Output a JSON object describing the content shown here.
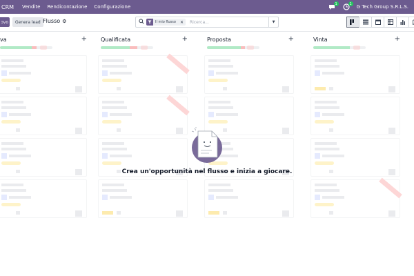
{
  "navbar": {
    "app_name": "CRM",
    "menus": [
      "Vendite",
      "Rendicontazione",
      "Configurazione"
    ],
    "company": "G Tech Group S.R.L.S.",
    "chat_badge": "1",
    "activity_badge": "1",
    "chat_icon": "chat-icon",
    "activity_icon": "clock-icon"
  },
  "control": {
    "new_button": "Nuovo",
    "generate_lead": "Genera lead",
    "breadcrumb": "Flusso",
    "facet_label": "Il mio flusso",
    "search_placeholder": "Ricerca..."
  },
  "views": [
    "kanban",
    "list",
    "calendar",
    "pivot",
    "graph",
    "map",
    "activity"
  ],
  "columns": [
    {
      "title": "Nuova",
      "display_title": "va"
    },
    {
      "title": "Qualificata"
    },
    {
      "title": "Proposta"
    },
    {
      "title": "Vinta"
    }
  ],
  "empty_state": {
    "message": "Crea un'opportunità nel flusso e inizia a giocare."
  },
  "colors": {
    "brand": "#6c5b8f",
    "badge": "#22c55e"
  }
}
